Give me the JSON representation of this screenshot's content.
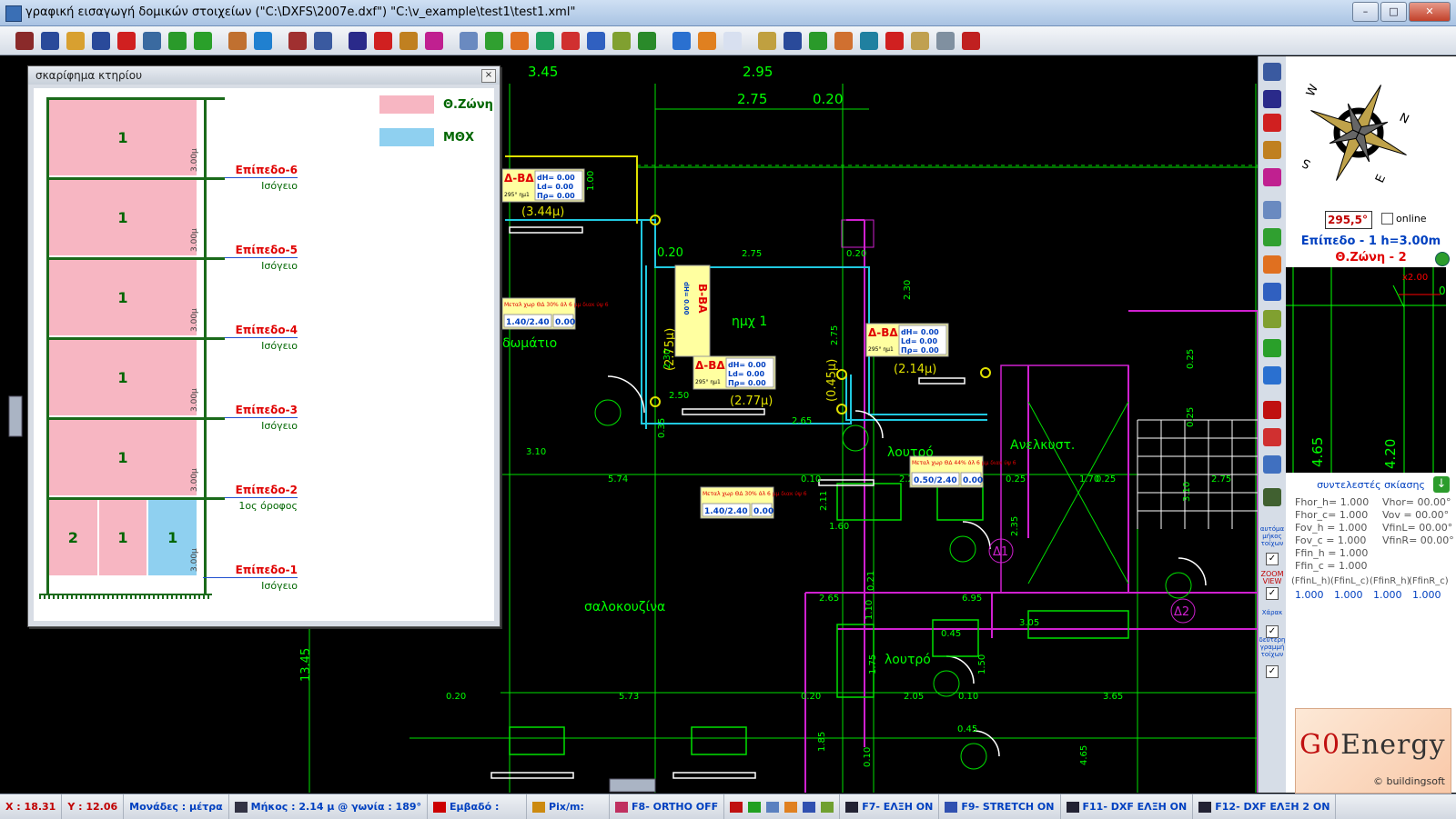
{
  "window": {
    "title": "γραφική εισαγωγή δομικών στοιχείων (\"C:\\DXFS\\2007e.dxf\") \"C:\\v_example\\test1\\test1.xml\"",
    "btn_min": "–",
    "btn_max": "□",
    "btn_close": "✕"
  },
  "toolbar_icons": [
    "edit-icon",
    "dxf-icon",
    "open-folder-icon",
    "save-icon",
    "cancel-icon",
    "layers-icon",
    "download-icon",
    "confirm-icon",
    "house-icon",
    "swap-icon",
    "tools-icon",
    "wall-icon",
    "dimension-icon",
    "shading-icon",
    "pencil-icon",
    "line-icon",
    "copy-icon",
    "add-icon",
    "move-icon",
    "rotate-icon",
    "delete-icon",
    "stretch-icon",
    "refresh-icon",
    "back-icon",
    "up-icon",
    "forward-icon",
    "new-page-icon",
    "xml-icon",
    "save-disk-icon",
    "green-save-icon",
    "house2-icon",
    "pipe-icon",
    "target-icon",
    "clipboard-icon",
    "calculator-icon",
    "pdf-icon"
  ],
  "sketch": {
    "title": "σκαρίφημα κτηρίου",
    "close": "×",
    "legend": [
      {
        "label": "Θ.Ζώνη",
        "color": "#f7b6c2"
      },
      {
        "label": "ΜΘΧ",
        "color": "#8fd0f0"
      }
    ],
    "levels": [
      {
        "name": "Επίπεδο-6",
        "sub": "Ισόγειο",
        "height": "3.00μ",
        "zones": [
          "1"
        ]
      },
      {
        "name": "Επίπεδο-5",
        "sub": "Ισόγειο",
        "height": "3.00μ",
        "zones": [
          "1"
        ]
      },
      {
        "name": "Επίπεδο-4",
        "sub": "Ισόγειο",
        "height": "3.00μ",
        "zones": [
          "1"
        ]
      },
      {
        "name": "Επίπεδο-3",
        "sub": "Ισόγειο",
        "height": "3.00μ",
        "zones": [
          "1"
        ]
      },
      {
        "name": "Επίπεδο-2",
        "sub": "1ος όροφος",
        "height": "3.00μ",
        "zones": [
          "1"
        ]
      },
      {
        "name": "Επίπεδο-1",
        "sub": "Ισόγειο",
        "height": "3.00μ",
        "zones": [
          "2",
          "1",
          "1"
        ]
      }
    ]
  },
  "cad": {
    "dims_top": [
      "3.45",
      "2.95",
      "2.75",
      "0.20"
    ],
    "rooms": [
      "ημχ 1",
      "δωμάτιο",
      "λουτρό",
      "Ανελκυστ.",
      "σαλοκουζίνα",
      "λουτρό"
    ],
    "labels_green": [
      "0.20",
      "2.75",
      "0.20",
      "2.30",
      "2.75",
      "2.30",
      "2.50",
      "2.65",
      "0.35",
      "3.10",
      "5.74",
      "0.10",
      "2.25",
      "0.25",
      "1.70",
      "0.25",
      "2.75",
      "2.35",
      "1.60",
      "2.11",
      "1.10",
      "0.21",
      "2.65",
      "6.95",
      "3.05",
      "0.45",
      "13.45",
      "0.20",
      "5.73",
      "0.20",
      "2.05",
      "0.10",
      "3.65",
      "1.75",
      "1.50",
      "0.45",
      "1.85",
      "0.10",
      "4.65",
      "1.00",
      "0.25",
      "0.25",
      "3.10"
    ],
    "yellow": [
      "(3.44μ)",
      "(2.75μ)",
      "(2.77μ)",
      "(2.14μ)",
      "(0.45μ)"
    ],
    "tags": [
      {
        "title": "Δ-ΒΔ",
        "dH": "dH= 0.00",
        "Ld": "Ld= 0.00",
        "Pp": "Πρ= 0.00",
        "small": "295° ημ1"
      },
      {
        "title": "Δ-ΒΔ",
        "dH": "dH= 0.00",
        "Ld": "Ld= 0.00",
        "Pp": "Πρ= 0.00",
        "small": "295° ημ1"
      },
      {
        "title": "Δ-ΒΔ",
        "dH": "dH= 0.00",
        "Ld": "Ld= 0.00",
        "Pp": "Πρ= 0.00",
        "small": "295° ημ1"
      },
      {
        "title": "Β-ΒΑ",
        "dH": "dH= 0.00",
        "Ld": "Ld= 0.00",
        "Pp": "Πρ= 0.00",
        "small": "25° ημ1"
      }
    ],
    "windows": [
      {
        "text": "Μεταλ χωρ ΘΔ 30% άλ 6 μμ διακ ύψ 6",
        "dims": "1.40/2.40",
        "u": "0.00"
      },
      {
        "text": "Μεταλ χωρ ΘΔ 30% άλ 6 μμ διακ ύψ 6",
        "dims": "1.40/2.40",
        "u": "0.00"
      },
      {
        "text": "Μεταλ χωρ ΘΔ 44% άλ 6 μμ διακ ύψ 6",
        "dims": "0.50/2.40",
        "u": "0.00"
      }
    ],
    "door_labels": [
      "Δ1",
      "Δ2"
    ]
  },
  "right_toolbar": {
    "icons": [
      "wall-tool-icon",
      "dimension-tool-icon",
      "shade-tool-icon",
      "edit-tool-icon",
      "line-tool-icon",
      "copy-tool-icon",
      "add-tool-icon",
      "move-tool-icon",
      "stretch-tool-icon",
      "refresh-tool-icon",
      "confirm-tool-icon",
      "up-tool-icon",
      "door-tool-icon",
      "grid-tool-icon",
      "swap-tool-icon",
      "hand-tool-icon"
    ],
    "options": [
      "αυτόμα μήκος τοίχων",
      "ZOOM VIEW",
      "Χάρακ",
      "δεύτερη γραμμή τοίχων"
    ]
  },
  "right_panel": {
    "compass_letters": [
      "W",
      "N",
      "S",
      "E"
    ],
    "orientation": "295,5°",
    "online_label": "online",
    "level_title": "Επίπεδο - 1  h=3.00m",
    "zone_title": "Θ.Ζώνη - 2",
    "mini_labels": [
      "x2.00",
      "0.",
      "4.65",
      "4.20"
    ],
    "shading_title": "συντελεστές σκίασης",
    "coefs_left": [
      "Fhor_h= 1.000",
      "Fhor_c= 1.000",
      "Fov_h = 1.000",
      "Fov_c = 1.000",
      "Ffin_h = 1.000",
      "Ffin_c = 1.000"
    ],
    "coefs_right": [
      "Vhor= 00.00°",
      "Vov = 00.00°",
      "VfinL= 00.00°",
      "VfinR= 00.00°"
    ],
    "fin_headers": [
      "(FfinL_h)",
      "(FfinL_c)",
      "(FfinR_h)",
      "(FfinR_c)"
    ],
    "fin_values": [
      "1.000",
      "1.000",
      "1.000",
      "1.000"
    ],
    "logo_brand_a": "G0",
    "logo_brand_b": "Energy",
    "logo_maker": "© buildingsoft"
  },
  "status": {
    "x": "X : 18.31",
    "y": "Y : 12.06",
    "units": "Μονάδες : μέτρα",
    "length": "Μήκος : 2.14 μ @ γωνία : 189°",
    "area": "Εμβαδό :",
    "pixm": "Pix/m:",
    "f8": "F8- ORTHO OFF",
    "f7": "F7- ΕΛΞΗ ON",
    "f9": "F9- STRETCH ON",
    "f11": "F11- DXF ΕΛΞΗ ON",
    "f12": "F12- DXF ΕΛΞΗ 2 ON"
  }
}
